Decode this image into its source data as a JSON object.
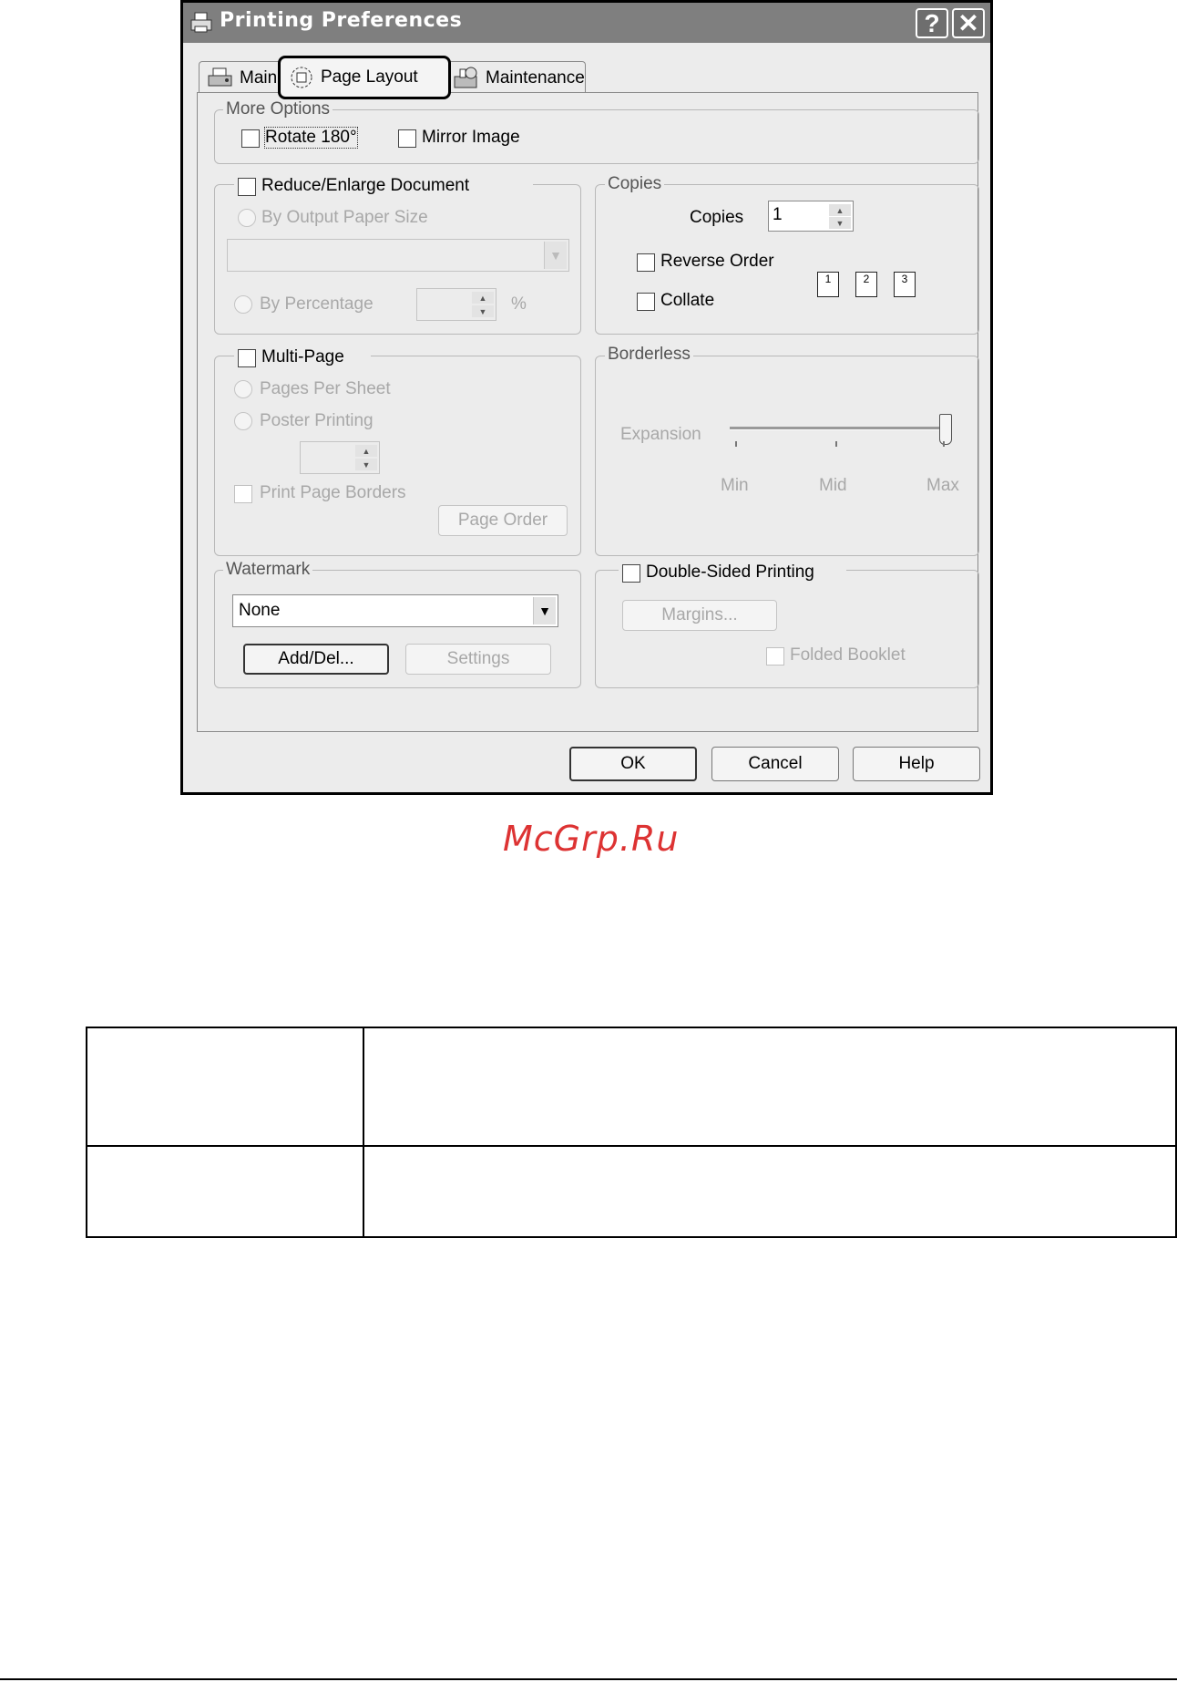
{
  "window": {
    "title": "Printing Preferences",
    "help_glyph": "?",
    "close_glyph": "✕"
  },
  "tabs": [
    {
      "label": "Main",
      "icon": "printer-icon"
    },
    {
      "label": "Page Layout",
      "icon": "page-layout-icon",
      "selected": true
    },
    {
      "label": "Maintenance",
      "icon": "maintenance-icon"
    }
  ],
  "more_options": {
    "legend": "More Options",
    "rotate_label": "Rotate 180°",
    "mirror_label": "Mirror Image"
  },
  "reduce_enlarge": {
    "label": "Reduce/Enlarge Document",
    "by_output_label": "By Output Paper Size",
    "paper_size_value": "",
    "by_percentage_label": "By Percentage",
    "percentage_value": "",
    "percent_symbol": "%"
  },
  "copies": {
    "legend": "Copies",
    "copies_label": "Copies",
    "copies_value": "1",
    "reverse_order_label": "Reverse Order",
    "collate_label": "Collate",
    "collate_pages": [
      "1",
      "2",
      "3"
    ]
  },
  "multi_page": {
    "label": "Multi-Page",
    "pages_per_sheet_label": "Pages Per Sheet",
    "poster_printing_label": "Poster Printing",
    "poster_value": "",
    "print_page_borders_label": "Print Page Borders",
    "page_order_button": "Page Order"
  },
  "borderless": {
    "legend": "Borderless",
    "expansion_label": "Expansion",
    "slider_level": "Max",
    "tick_min": "Min",
    "tick_mid": "Mid",
    "tick_max": "Max"
  },
  "watermark": {
    "legend": "Watermark",
    "selected": "None",
    "add_del_button": "Add/Del...",
    "settings_button": "Settings"
  },
  "double_sided": {
    "label": "Double-Sided Printing",
    "margins_button": "Margins...",
    "folded_booklet_label": "Folded Booklet"
  },
  "buttons": {
    "ok": "OK",
    "cancel": "Cancel",
    "help": "Help"
  },
  "site_watermark": "McGrp.Ru"
}
